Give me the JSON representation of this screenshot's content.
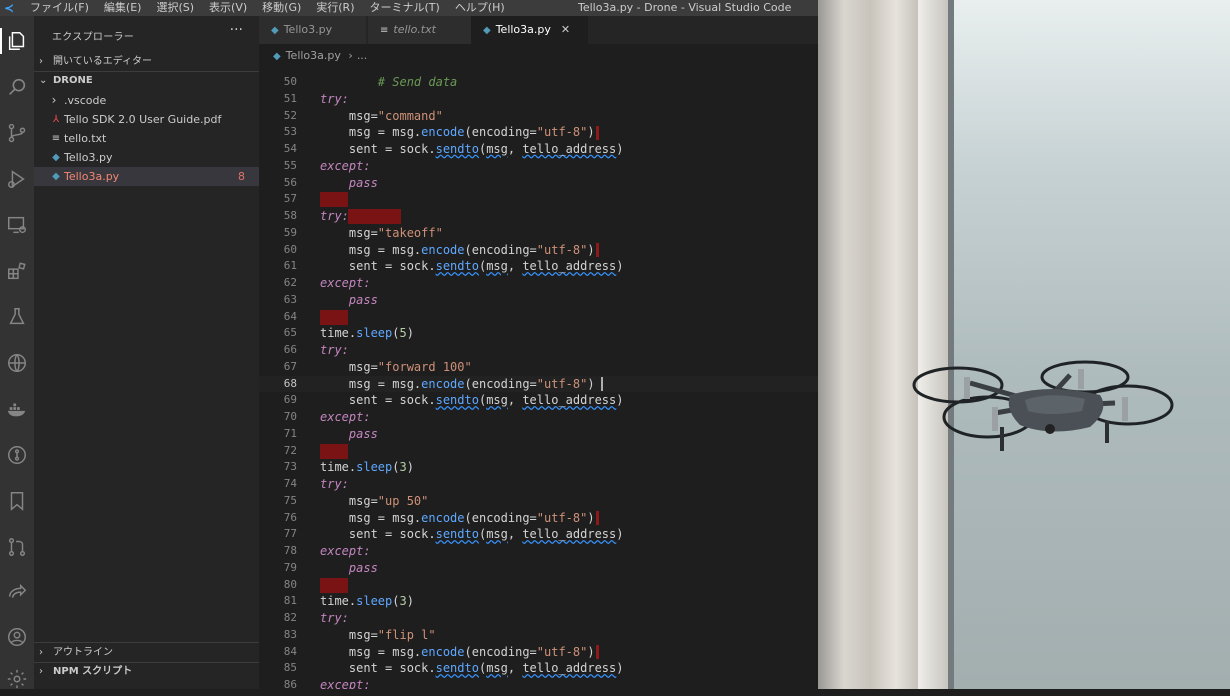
{
  "titlebar": {
    "menus": [
      "ファイル(F)",
      "編集(E)",
      "選択(S)",
      "表示(V)",
      "移動(G)",
      "実行(R)",
      "ターミナル(T)",
      "ヘルプ(H)"
    ],
    "window_title": "Tello3a.py - Drone - Visual Studio Code"
  },
  "activity_bar": {
    "icons": [
      "explorer-icon",
      "search-icon",
      "source-control-icon",
      "run-debug-icon",
      "remote-explorer-icon",
      "extensions-icon",
      "testing-icon",
      "globe-icon",
      "docker-icon",
      "git-graph-icon",
      "bookmark-icon",
      "pull-request-icon",
      "live-share-icon",
      "account-icon",
      "settings-gear-icon"
    ]
  },
  "sidebar": {
    "header": "エクスプローラー",
    "more": "···",
    "open_editors": "開いているエディター",
    "folder": "DRONE",
    "files": [
      {
        "name": ".vscode",
        "kind": "folder"
      },
      {
        "name": "Tello SDK 2.0 User Guide.pdf",
        "kind": "pdf"
      },
      {
        "name": "tello.txt",
        "kind": "txt"
      },
      {
        "name": "Tello3.py",
        "kind": "py"
      },
      {
        "name": "Tello3a.py",
        "kind": "py",
        "badge": "8"
      }
    ],
    "outline": "アウトライン",
    "npm": "NPM スクリプト"
  },
  "tabs": [
    {
      "label": "Tello3.py",
      "icon": "python-icon"
    },
    {
      "label": "tello.txt",
      "icon": "text-file-icon"
    },
    {
      "label": "Tello3a.py",
      "icon": "python-icon",
      "close": "✕"
    }
  ],
  "breadcrumb": {
    "file": "Tello3a.py",
    "rest": "..."
  },
  "code": {
    "line_numbers": [
      "50",
      "51",
      "52",
      "53",
      "54",
      "55",
      "56",
      "57",
      "58",
      "59",
      "60",
      "61",
      "62",
      "63",
      "64",
      "65",
      "66",
      "67",
      "68",
      "69",
      "70",
      "71",
      "72",
      "73",
      "74",
      "75",
      "76",
      "77",
      "78",
      "79",
      "80",
      "81",
      "82",
      "83",
      "84",
      "85",
      "86"
    ],
    "comment": "# Send data",
    "kw_try": "try:",
    "kw_except": "except:",
    "kw_pass": "pass",
    "msg_assign": "msg=",
    "cmd_command": "\"command\"",
    "cmd_takeoff": "\"takeoff\"",
    "cmd_forward": "\"forward 100\"",
    "cmd_up": "\"up 50\"",
    "cmd_flip": "\"flip l\"",
    "encode_prefix": "msg = msg.",
    "encode_fn": "encode",
    "encode_args_open": "(encoding=",
    "encode_str": "\"utf-8\"",
    "encode_close": ")",
    "sent_prefix": "sent = sock.",
    "sendto_fn": "sendto",
    "sendto_args": [
      "msg",
      "tello_address"
    ],
    "time_prefix": "time.",
    "sleep_fn": "sleep",
    "sleep_5": "5",
    "sleep_3": "3"
  },
  "photo": {
    "subject": "drone-photo"
  }
}
